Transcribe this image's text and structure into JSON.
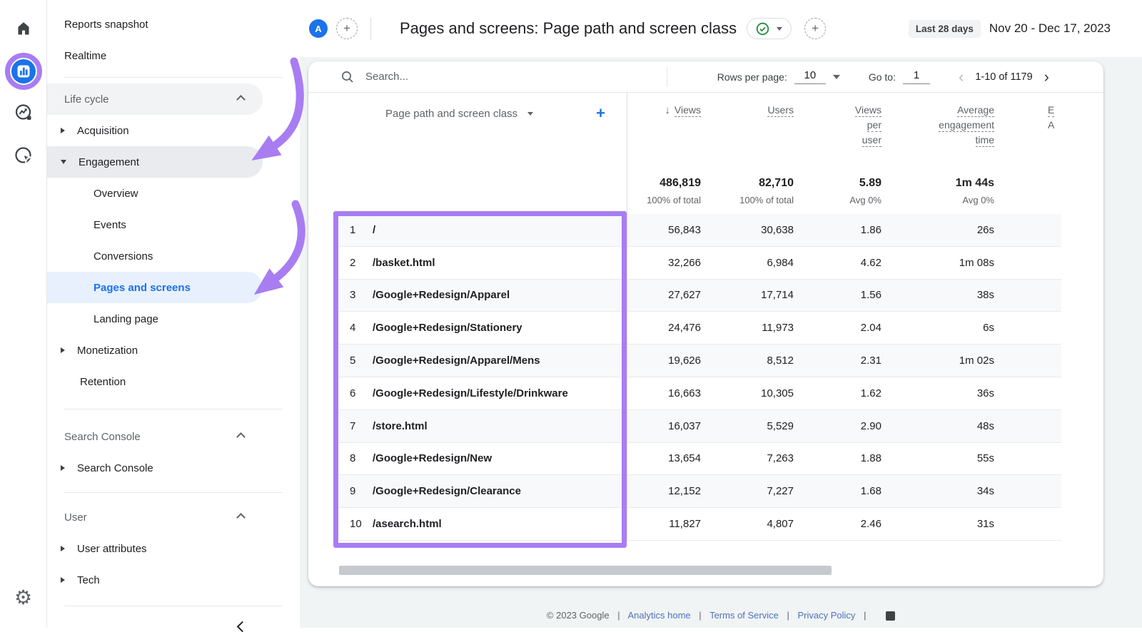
{
  "header": {
    "avatar_letter": "A",
    "title": "Pages and screens: Page path and screen class",
    "date_preset": "Last 28 days",
    "date_range": "Nov 20 - Dec 17, 2023"
  },
  "toolbar": {
    "search_placeholder": "Search...",
    "rows_per_page_label": "Rows per page:",
    "rows_per_page_value": "10",
    "goto_label": "Go to:",
    "goto_value": "1",
    "range_text": "1-10 of 1179"
  },
  "icons": {
    "plus": "+",
    "sort_desc": "↓",
    "prev": "‹",
    "next": "›"
  },
  "sidebar": {
    "reports_snapshot": "Reports snapshot",
    "realtime": "Realtime",
    "life_cycle": "Life cycle",
    "acquisition": "Acquisition",
    "engagement": "Engagement",
    "overview": "Overview",
    "events": "Events",
    "conversions": "Conversions",
    "pages_and_screens": "Pages and screens",
    "landing_page": "Landing page",
    "monetization": "Monetization",
    "retention": "Retention",
    "search_console_header": "Search Console",
    "search_console_item": "Search Console",
    "user_header": "User",
    "user_attributes": "User attributes",
    "tech": "Tech"
  },
  "table": {
    "dimension_header": "Page path and screen class",
    "col_views": "Views",
    "col_users": "Users",
    "vpu_lines": [
      "Views",
      "per",
      "user"
    ],
    "aet_lines": [
      "Average",
      "engagement",
      "time"
    ],
    "clipped_col_line1": "E",
    "clipped_col_line2": "A",
    "totals": {
      "views": "486,819",
      "views_sub": "100% of total",
      "users": "82,710",
      "users_sub": "100% of total",
      "views_per_user": "5.89",
      "views_per_user_sub": "Avg 0%",
      "avg_engagement": "1m 44s",
      "avg_engagement_sub": "Avg 0%"
    },
    "rows": [
      {
        "rank": "1",
        "path": "/",
        "views": "56,843",
        "users": "30,638",
        "views_per_user": "1.86",
        "avg_engagement_time": "26s"
      },
      {
        "rank": "2",
        "path": "/basket.html",
        "views": "32,266",
        "users": "6,984",
        "views_per_user": "4.62",
        "avg_engagement_time": "1m 08s"
      },
      {
        "rank": "3",
        "path": "/Google+Redesign/Apparel",
        "views": "27,627",
        "users": "17,714",
        "views_per_user": "1.56",
        "avg_engagement_time": "38s"
      },
      {
        "rank": "4",
        "path": "/Google+Redesign/Stationery",
        "views": "24,476",
        "users": "11,973",
        "views_per_user": "2.04",
        "avg_engagement_time": "6s"
      },
      {
        "rank": "5",
        "path": "/Google+Redesign/Apparel/Mens",
        "views": "19,626",
        "users": "8,512",
        "views_per_user": "2.31",
        "avg_engagement_time": "1m 02s"
      },
      {
        "rank": "6",
        "path": "/Google+Redesign/Lifestyle/Drinkware",
        "views": "16,663",
        "users": "10,305",
        "views_per_user": "1.62",
        "avg_engagement_time": "36s"
      },
      {
        "rank": "7",
        "path": "/store.html",
        "views": "16,037",
        "users": "5,529",
        "views_per_user": "2.90",
        "avg_engagement_time": "48s"
      },
      {
        "rank": "8",
        "path": "/Google+Redesign/New",
        "views": "13,654",
        "users": "7,263",
        "views_per_user": "1.88",
        "avg_engagement_time": "55s"
      },
      {
        "rank": "9",
        "path": "/Google+Redesign/Clearance",
        "views": "12,152",
        "users": "7,227",
        "views_per_user": "1.68",
        "avg_engagement_time": "34s"
      },
      {
        "rank": "10",
        "path": "/asearch.html",
        "views": "11,827",
        "users": "4,807",
        "views_per_user": "2.46",
        "avg_engagement_time": "31s"
      }
    ]
  },
  "footer": {
    "copyright": "© 2023 Google",
    "sep": "|",
    "link1": "Analytics home",
    "link2": "Terms of Service",
    "link3": "Privacy Policy"
  },
  "colors": {
    "accent_blue": "#1a73e8",
    "annotation_purple": "#a87df2",
    "check_green": "#1e8e3e",
    "selected_bg": "#e8f0fe"
  }
}
